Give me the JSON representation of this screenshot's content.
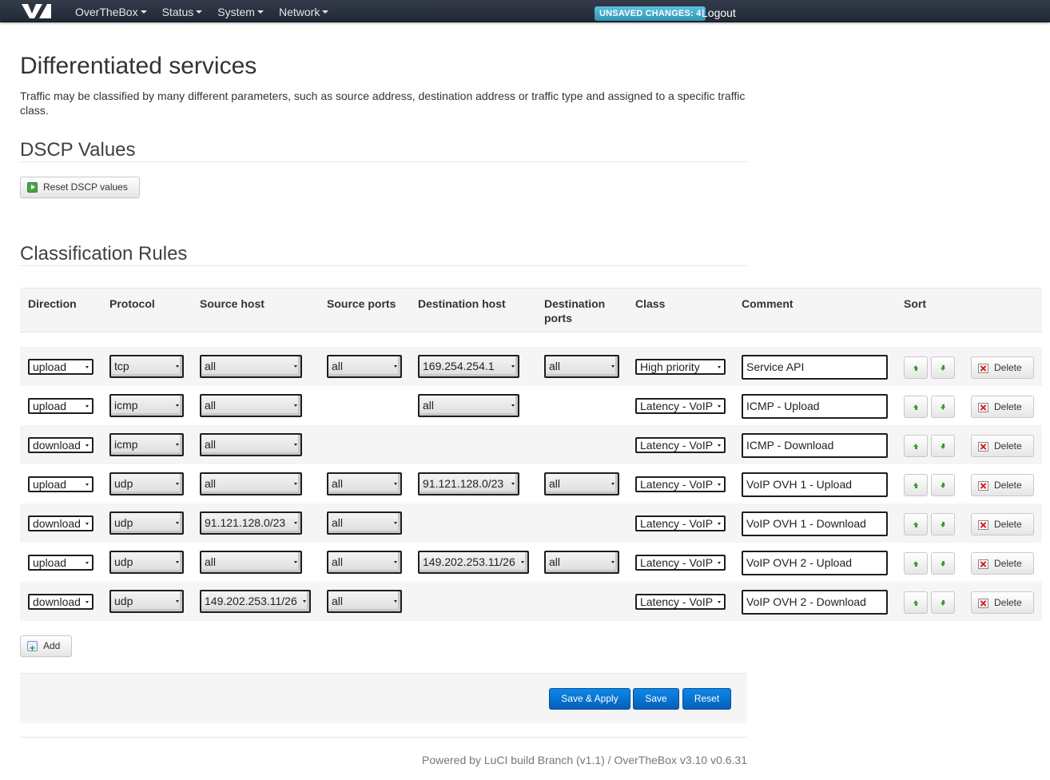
{
  "nav": {
    "items": [
      "OverTheBox",
      "Status",
      "System",
      "Network"
    ],
    "unsaved_badge": "UNSAVED CHANGES: 4",
    "logout": "Logout"
  },
  "page": {
    "title": "Differentiated services",
    "description": "Traffic may be classified by many different parameters, such as source address, destination address or traffic type and assigned to a specific traffic class."
  },
  "dscp": {
    "title": "DSCP Values",
    "reset_button": "Reset DSCP values"
  },
  "rules": {
    "title": "Classification Rules",
    "headers": {
      "direction": "Direction",
      "protocol": "Protocol",
      "source_host": "Source host",
      "source_ports": "Source ports",
      "destination_host": "Destination host",
      "destination_ports": "Destination ports",
      "class": "Class",
      "comment": "Comment",
      "sort": "Sort"
    },
    "delete_label": "Delete",
    "add_label": "Add",
    "rows": [
      {
        "direction": "upload",
        "protocol": "tcp",
        "source_host": "all",
        "source_ports": "all",
        "destination_host": "169.254.254.1",
        "destination_ports": "all",
        "class": "High priority",
        "comment": "Service API"
      },
      {
        "direction": "upload",
        "protocol": "icmp",
        "source_host": "all",
        "source_ports": "",
        "destination_host": "all",
        "destination_ports": "",
        "class": "Latency - VoIP",
        "comment": "ICMP - Upload"
      },
      {
        "direction": "download",
        "protocol": "icmp",
        "source_host": "all",
        "source_ports": "",
        "destination_host": "",
        "destination_ports": "",
        "class": "Latency - VoIP",
        "comment": "ICMP - Download"
      },
      {
        "direction": "upload",
        "protocol": "udp",
        "source_host": "all",
        "source_ports": "all",
        "destination_host": "91.121.128.0/23",
        "destination_ports": "all",
        "class": "Latency - VoIP",
        "comment": "VoIP OVH 1 - Upload"
      },
      {
        "direction": "download",
        "protocol": "udp",
        "source_host": "91.121.128.0/23",
        "source_ports": "all",
        "destination_host": "",
        "destination_ports": "",
        "class": "Latency - VoIP",
        "comment": "VoIP OVH 1 - Download"
      },
      {
        "direction": "upload",
        "protocol": "udp",
        "source_host": "all",
        "source_ports": "all",
        "destination_host": "149.202.253.11/26",
        "destination_ports": "all",
        "class": "Latency - VoIP",
        "comment": "VoIP OVH 2 - Upload"
      },
      {
        "direction": "download",
        "protocol": "udp",
        "source_host": "149.202.253.11/26",
        "source_ports": "all",
        "destination_host": "",
        "destination_ports": "",
        "class": "Latency - VoIP",
        "comment": "VoIP OVH 2 - Download"
      }
    ]
  },
  "actions": {
    "save_apply": "Save & Apply",
    "save": "Save",
    "reset": "Reset"
  },
  "footer": "Powered by LuCI build Branch (v1.1) / OverTheBox v3.10 v0.6.31"
}
